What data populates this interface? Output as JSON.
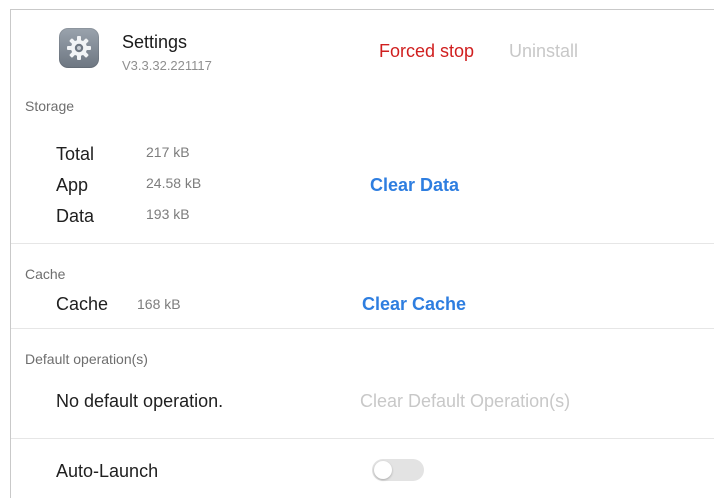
{
  "app": {
    "name": "Settings",
    "version": "V3.3.32.221117",
    "icon": "gear-icon"
  },
  "actions": {
    "forced_stop": "Forced stop",
    "uninstall": "Uninstall"
  },
  "storage": {
    "section_label": "Storage",
    "rows": [
      {
        "label": "Total",
        "value": "217 kB"
      },
      {
        "label": "App",
        "value": "24.58 kB"
      },
      {
        "label": "Data",
        "value": "193 kB"
      }
    ],
    "clear_label": "Clear Data"
  },
  "cache": {
    "section_label": "Cache",
    "label": "Cache",
    "value": "168 kB",
    "clear_label": "Clear Cache"
  },
  "default_ops": {
    "section_label": "Default operation(s)",
    "status": "No default operation.",
    "clear_label": "Clear Default Operation(s)"
  },
  "auto_launch": {
    "label": "Auto-Launch",
    "enabled": false
  },
  "colors": {
    "danger": "#d01f1f",
    "accent": "#2e7ee0",
    "disabled": "#c8c8c8"
  }
}
